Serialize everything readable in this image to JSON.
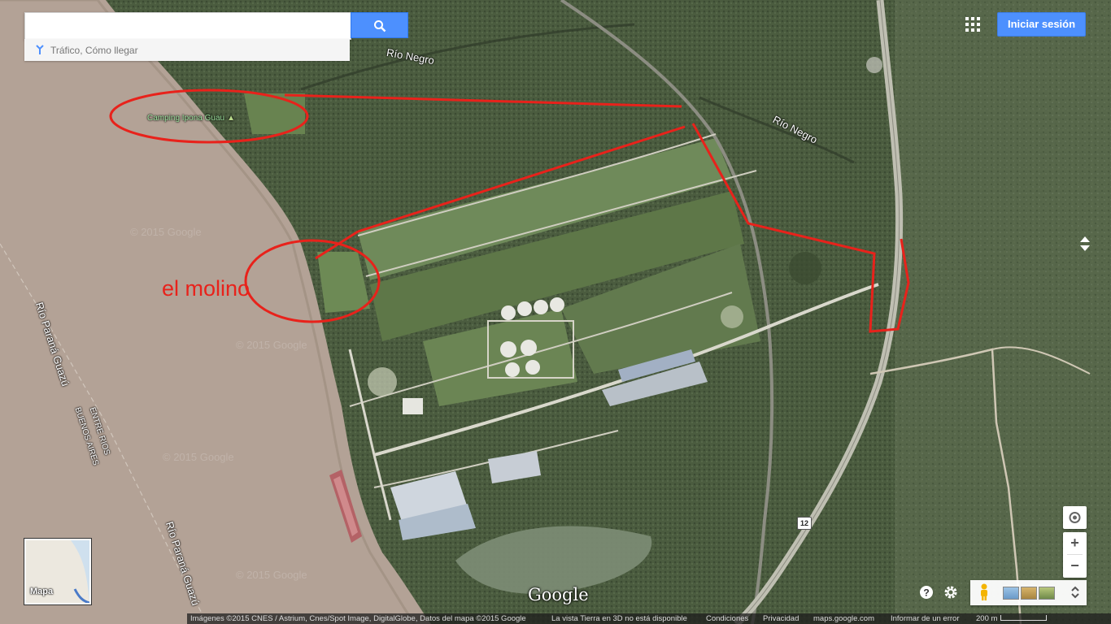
{
  "search": {
    "placeholder": "",
    "button_icon": "search-icon",
    "directions_label": "Tráfico, Cómo llegar"
  },
  "header": {
    "signin_label": "Iniciar sesión",
    "apps_icon": "apps-grid-icon"
  },
  "map_labels": {
    "rio_negro_top": "Río Negro",
    "rio_negro_right": "Río Negro",
    "camping": "Camping Ipona Guau",
    "rio_parana_1": "Río Paraná Guazú",
    "rio_parana_2": "Río Paraná Guazú",
    "province_border_1": "ENTRE RIOS",
    "province_border_2": "BUENOS AIRES",
    "annotation": "el molino",
    "route_shield": "12",
    "watermark": "© 2015 Google"
  },
  "minimap": {
    "label": "Mapa"
  },
  "controls": {
    "location_icon": "my-location-icon",
    "zoom_in": "+",
    "zoom_out": "−",
    "compass_icon": "compass-icon",
    "help_icon": "help-icon",
    "settings_icon": "gear-icon",
    "pegman_icon": "pegman-icon",
    "expand_icon": "chevron-expand-icon"
  },
  "footer": {
    "logo": "Google",
    "imagery_credit": "Imágenes ©2015 CNES / Astrium, Cnes/Spot Image, DigitalGlobe, Datos del mapa ©2015 Google",
    "no_3d": "La vista Tierra en 3D no está disponible",
    "conditions": "Condiciones",
    "privacy": "Privacidad",
    "site": "maps.google.com",
    "report": "Informar de un error",
    "scale": "200 m"
  },
  "colors": {
    "annotation_red": "#e8221b",
    "button_blue": "#4d90fe",
    "water": "#b3a296",
    "vegetation": "#4a5b3f"
  }
}
